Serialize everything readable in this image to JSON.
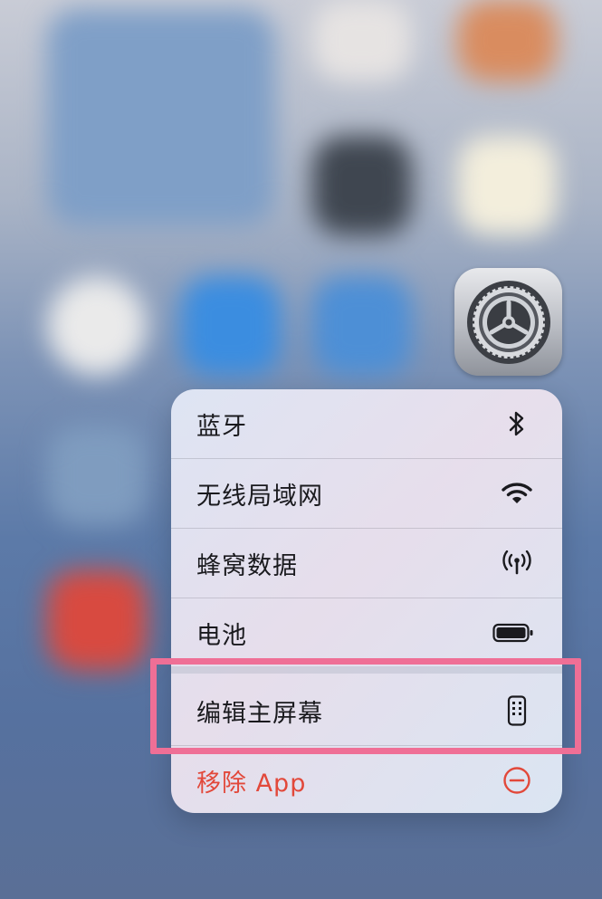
{
  "menu": {
    "items": [
      {
        "label": "蓝牙",
        "icon": "bluetooth-icon"
      },
      {
        "label": "无线局域网",
        "icon": "wifi-icon"
      },
      {
        "label": "蜂窝数据",
        "icon": "cellular-icon"
      },
      {
        "label": "电池",
        "icon": "battery-icon"
      },
      {
        "label": "编辑主屏幕",
        "icon": "phone-icon"
      },
      {
        "label": "移除 App",
        "icon": "minus-circle-icon"
      }
    ]
  },
  "colors": {
    "danger": "#e2483a",
    "highlight": "#ef6f96"
  },
  "app": {
    "icon": "settings-gear-icon"
  }
}
